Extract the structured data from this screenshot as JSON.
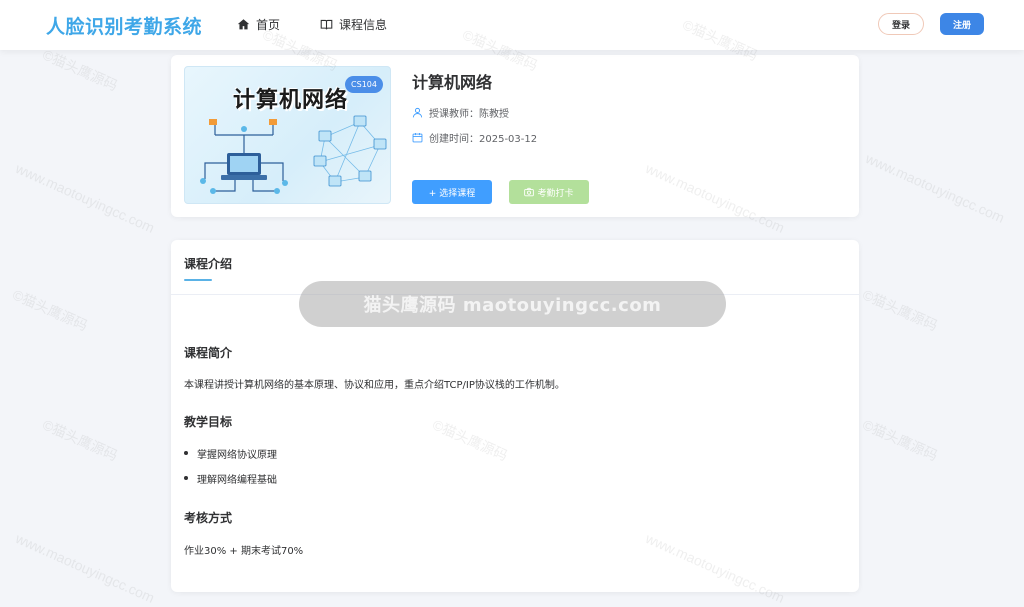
{
  "header": {
    "logo": "人脸识别考勤系统",
    "nav": [
      {
        "label": "首页",
        "icon": "home-icon"
      },
      {
        "label": "课程信息",
        "icon": "book-icon"
      }
    ],
    "login_label": "登录",
    "register_label": "注册"
  },
  "course": {
    "cover_title": "计算机网络",
    "code": "CS104",
    "title": "计算机网络",
    "teacher": "授课教师：陈教授",
    "created": "创建时间：2025-03-12",
    "select_label": "+ 选择课程",
    "checkin_label": "考勤打卡"
  },
  "intro": {
    "tab": "课程介绍",
    "summary_title": "课程简介",
    "summary_text": "本课程讲授计算机网络的基本原理、协议和应用，重点介绍TCP/IP协议栈的工作机制。",
    "goals_title": "教学目标",
    "goals": [
      "掌握网络协议原理",
      "理解网络编程基础"
    ],
    "assessment_title": "考核方式",
    "assessment_text": "作业30% + 期末考试70%"
  },
  "watermark": {
    "center": "猫头鹰源码 maotouyingcc.com",
    "tile_a": "©猫头鹰源码",
    "tile_b": "www.maotouyingcc.com"
  },
  "colors": {
    "primary": "#409eff",
    "logo": "#3fa7e8",
    "success_disabled": "#b3e09b"
  }
}
